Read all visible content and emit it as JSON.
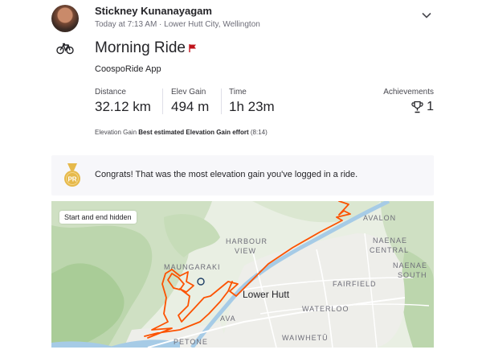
{
  "header": {
    "athlete_name": "Stickney Kunanayagam",
    "meta": "Today at 7:13 AM · Lower Hutt City, Wellington"
  },
  "activity": {
    "title": "Morning Ride",
    "device": "CoospoRide App",
    "sport_icon": "bike-icon",
    "flag_icon": "flag-icon",
    "stats": [
      {
        "label": "Distance",
        "value": "32.12 km"
      },
      {
        "label": "Elev Gain",
        "value": "494 m"
      },
      {
        "label": "Time",
        "value": "1h 23m"
      }
    ],
    "achievements": {
      "label": "Achievements",
      "value": "1",
      "icon": "trophy-icon"
    },
    "elevation_note": {
      "prefix": "Elevation Gain",
      "highlight": "Best estimated Elevation Gain effort",
      "suffix": "(8:14)"
    }
  },
  "congrats": {
    "text": "Congrats! That was the most elevation gain you've logged in a ride.",
    "badge_label": "PR"
  },
  "map": {
    "badge": "Start and end hidden",
    "route_color": "#fc5200",
    "labels": {
      "avalon": "AVALON",
      "harbour": "HARBOUR",
      "view": "VIEW",
      "naenae_central_1": "NAENAE",
      "naenae_central_2": "CENTRAL",
      "naenae_south_1": "NAENAE",
      "naenae_south_2": "SOUTH",
      "maungaraki": "MAUNGARAKI",
      "lower_hutt": "Lower Hutt",
      "fairfield": "FAIRFIELD",
      "waterloo": "WATERLOO",
      "ava": "AVA",
      "petone": "PETONE",
      "waiwhetu": "WAIWHETŪ"
    }
  },
  "colors": {
    "accent": "#fc5200",
    "text": "#242428",
    "muted": "#6d6d78"
  }
}
